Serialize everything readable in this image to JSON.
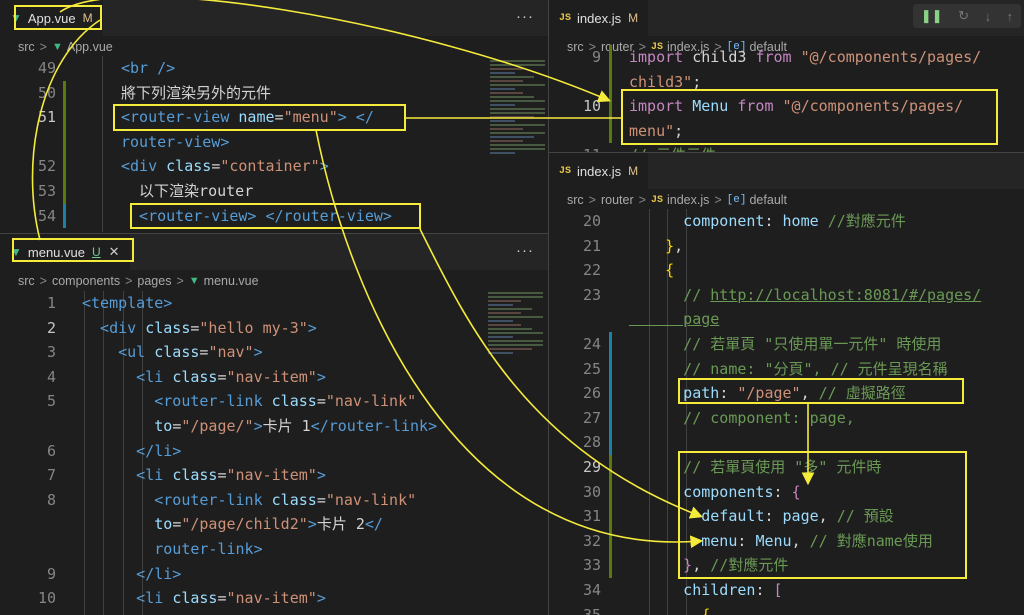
{
  "colors": {
    "highlight_box": "#f5eb3b",
    "vue_icon": "#41b883",
    "js_icon": "#e8c547",
    "git_modified": "#e2c08d",
    "git_untracked": "#73c991",
    "gutter_added": "#587c0c",
    "gutter_modified": "#1b81a8"
  },
  "app_pane": {
    "tab": {
      "icon": "vue-icon",
      "label": "App.vue",
      "badge": "M"
    },
    "more": "···",
    "breadcrumb": {
      "root": "src",
      "file": "App.vue"
    },
    "lines": [
      {
        "n": "49",
        "code": [
          [
            "t",
            "<br />"
          ]
        ]
      },
      {
        "n": "50",
        "code": [
          [
            "w",
            "將下列渲染另外的元件"
          ]
        ]
      },
      {
        "n": "51",
        "code": [
          [
            "t",
            "<router-view "
          ],
          [
            "a",
            "name"
          ],
          [
            "w",
            "="
          ],
          [
            "s",
            "\"menu\""
          ],
          [
            "t",
            "> </"
          ]
        ],
        "current": true
      },
      {
        "n": "",
        "code": [
          [
            "t",
            "router-view>"
          ]
        ]
      },
      {
        "n": "52",
        "code": [
          [
            "t",
            "<div "
          ],
          [
            "a",
            "class"
          ],
          [
            "w",
            "="
          ],
          [
            "s",
            "\"container\""
          ],
          [
            "t",
            ">"
          ]
        ]
      },
      {
        "n": "53",
        "code": [
          [
            "w",
            "  以下渲染router"
          ]
        ]
      },
      {
        "n": "54",
        "code": [
          [
            "t",
            "  <router-view> </router-view>"
          ]
        ]
      }
    ]
  },
  "menu_pane": {
    "tab": {
      "icon": "vue-icon",
      "label": "menu.vue",
      "badge": "U"
    },
    "more": "···",
    "breadcrumb": {
      "root": "src",
      "dir1": "components",
      "dir2": "pages",
      "file": "menu.vue"
    },
    "lines": [
      {
        "n": "1",
        "code": [
          [
            "t",
            "<template>"
          ]
        ]
      },
      {
        "n": "2",
        "code": [
          [
            "t",
            "  <div "
          ],
          [
            "a",
            "class"
          ],
          [
            "w",
            "="
          ],
          [
            "s",
            "\"hello my-3\""
          ],
          [
            "t",
            ">"
          ]
        ],
        "current": true
      },
      {
        "n": "3",
        "code": [
          [
            "t",
            "    <ul "
          ],
          [
            "a",
            "class"
          ],
          [
            "w",
            "="
          ],
          [
            "s",
            "\"nav\""
          ],
          [
            "t",
            ">"
          ]
        ]
      },
      {
        "n": "4",
        "code": [
          [
            "t",
            "      <li "
          ],
          [
            "a",
            "class"
          ],
          [
            "w",
            "="
          ],
          [
            "s",
            "\"nav-item\""
          ],
          [
            "t",
            ">"
          ]
        ]
      },
      {
        "n": "5",
        "code": [
          [
            "t",
            "        <router-link "
          ],
          [
            "a",
            "class"
          ],
          [
            "w",
            "="
          ],
          [
            "s",
            "\"nav-link\""
          ]
        ]
      },
      {
        "n": "",
        "code": [
          [
            "a",
            "        to"
          ],
          [
            "w",
            "="
          ],
          [
            "s",
            "\"/page/\""
          ],
          [
            "t",
            ">"
          ],
          [
            "w",
            "卡片 1"
          ],
          [
            "t",
            "</router-link>"
          ]
        ]
      },
      {
        "n": "6",
        "code": [
          [
            "t",
            "      </li>"
          ]
        ]
      },
      {
        "n": "7",
        "code": [
          [
            "t",
            "      <li "
          ],
          [
            "a",
            "class"
          ],
          [
            "w",
            "="
          ],
          [
            "s",
            "\"nav-item\""
          ],
          [
            "t",
            ">"
          ]
        ]
      },
      {
        "n": "8",
        "code": [
          [
            "t",
            "        <router-link "
          ],
          [
            "a",
            "class"
          ],
          [
            "w",
            "="
          ],
          [
            "s",
            "\"nav-link\""
          ]
        ]
      },
      {
        "n": "",
        "code": [
          [
            "a",
            "        to"
          ],
          [
            "w",
            "="
          ],
          [
            "s",
            "\"/page/child2\""
          ],
          [
            "t",
            ">"
          ],
          [
            "w",
            "卡片 2"
          ],
          [
            "t",
            "</"
          ]
        ]
      },
      {
        "n": "",
        "code": [
          [
            "t",
            "        router-link>"
          ]
        ]
      },
      {
        "n": "9",
        "code": [
          [
            "t",
            "      </li>"
          ]
        ]
      },
      {
        "n": "10",
        "code": [
          [
            "t",
            "      <li "
          ],
          [
            "a",
            "class"
          ],
          [
            "w",
            "="
          ],
          [
            "s",
            "\"nav-item\""
          ],
          [
            "t",
            ">"
          ]
        ]
      }
    ]
  },
  "index_top": {
    "tab": {
      "icon": "js-icon",
      "icon_text": "JS",
      "label": "index.js",
      "badge": "M"
    },
    "breadcrumb": {
      "root": "src",
      "dir1": "router",
      "file": "index.js",
      "symbol": "default"
    },
    "lines": [
      {
        "n": "9",
        "code": [
          [
            "k",
            "import "
          ],
          [
            "w",
            "child3 "
          ],
          [
            "k",
            "from "
          ],
          [
            "s",
            "\"@/components/pages/"
          ]
        ]
      },
      {
        "n": "",
        "code": [
          [
            "s",
            "child3\""
          ],
          [
            "w",
            ";"
          ]
        ]
      },
      {
        "n": "10",
        "code": [
          [
            "k",
            "import "
          ],
          [
            "a",
            "Menu "
          ],
          [
            "k",
            "from "
          ],
          [
            "s",
            "\"@/components/pages/"
          ]
        ],
        "current": true
      },
      {
        "n": "",
        "code": [
          [
            "s",
            "menu\""
          ],
          [
            "w",
            ";"
          ]
        ]
      },
      {
        "n": "11",
        "code": [
          [
            "c",
            "// 元件元件"
          ]
        ]
      }
    ]
  },
  "index_bottom": {
    "tab": {
      "icon": "js-icon",
      "icon_text": "JS",
      "label": "index.js",
      "badge": "M"
    },
    "breadcrumb": {
      "root": "src",
      "dir1": "router",
      "file": "index.js",
      "symbol": "default"
    },
    "lines": [
      {
        "n": "20",
        "code": [
          [
            "a",
            "      component"
          ],
          [
            "w",
            ": "
          ],
          [
            "a",
            "home "
          ],
          [
            "c",
            "//對應元件"
          ]
        ]
      },
      {
        "n": "21",
        "code": [
          [
            "y",
            "    }"
          ],
          [
            "w",
            ","
          ]
        ]
      },
      {
        "n": "22",
        "code": [
          [
            "y",
            "    {"
          ]
        ]
      },
      {
        "n": "23",
        "code": [
          [
            "c",
            "      // "
          ],
          [
            "cu",
            "http://localhost:8081/#/pages/"
          ]
        ]
      },
      {
        "n": "",
        "code": [
          [
            "cu",
            "      page"
          ]
        ]
      },
      {
        "n": "24",
        "code": [
          [
            "c",
            "      // 若單頁 \"只使用單一元件\" 時使用"
          ]
        ]
      },
      {
        "n": "25",
        "code": [
          [
            "c",
            "      // name: \"分頁\", // 元件呈現名稱"
          ]
        ]
      },
      {
        "n": "26",
        "code": [
          [
            "a",
            "      path"
          ],
          [
            "w",
            ": "
          ],
          [
            "s",
            "\"/page\""
          ],
          [
            "w",
            ", "
          ],
          [
            "c",
            "// 虛擬路徑"
          ]
        ]
      },
      {
        "n": "27",
        "code": [
          [
            "c",
            "      // component: page,"
          ]
        ]
      },
      {
        "n": "28",
        "code": []
      },
      {
        "n": "29",
        "code": [
          [
            "c",
            "      // 若單頁使用 \"多\" 元件時"
          ]
        ],
        "current": true
      },
      {
        "n": "30",
        "code": [
          [
            "a",
            "      components"
          ],
          [
            "w",
            ": "
          ],
          [
            "k",
            "{"
          ]
        ]
      },
      {
        "n": "31",
        "code": [
          [
            "a",
            "        default"
          ],
          [
            "w",
            ": "
          ],
          [
            "a",
            "page"
          ],
          [
            "w",
            ", "
          ],
          [
            "c",
            "// 預設"
          ]
        ]
      },
      {
        "n": "32",
        "code": [
          [
            "a",
            "        menu"
          ],
          [
            "w",
            ": "
          ],
          [
            "a",
            "Menu"
          ],
          [
            "w",
            ", "
          ],
          [
            "c",
            "// 對應name使用"
          ]
        ]
      },
      {
        "n": "33",
        "code": [
          [
            "k",
            "      }"
          ],
          [
            "w",
            ", "
          ],
          [
            "c",
            "//對應元件"
          ]
        ]
      },
      {
        "n": "34",
        "code": [
          [
            "a",
            "      children"
          ],
          [
            "w",
            ": "
          ],
          [
            "k",
            "["
          ]
        ]
      },
      {
        "n": "35",
        "code": [
          [
            "y",
            "        {"
          ]
        ]
      }
    ]
  },
  "debug_toolbar": [
    "pause-icon",
    "continue-icon",
    "step-over-icon",
    "step-into-icon",
    "step-out-icon"
  ]
}
